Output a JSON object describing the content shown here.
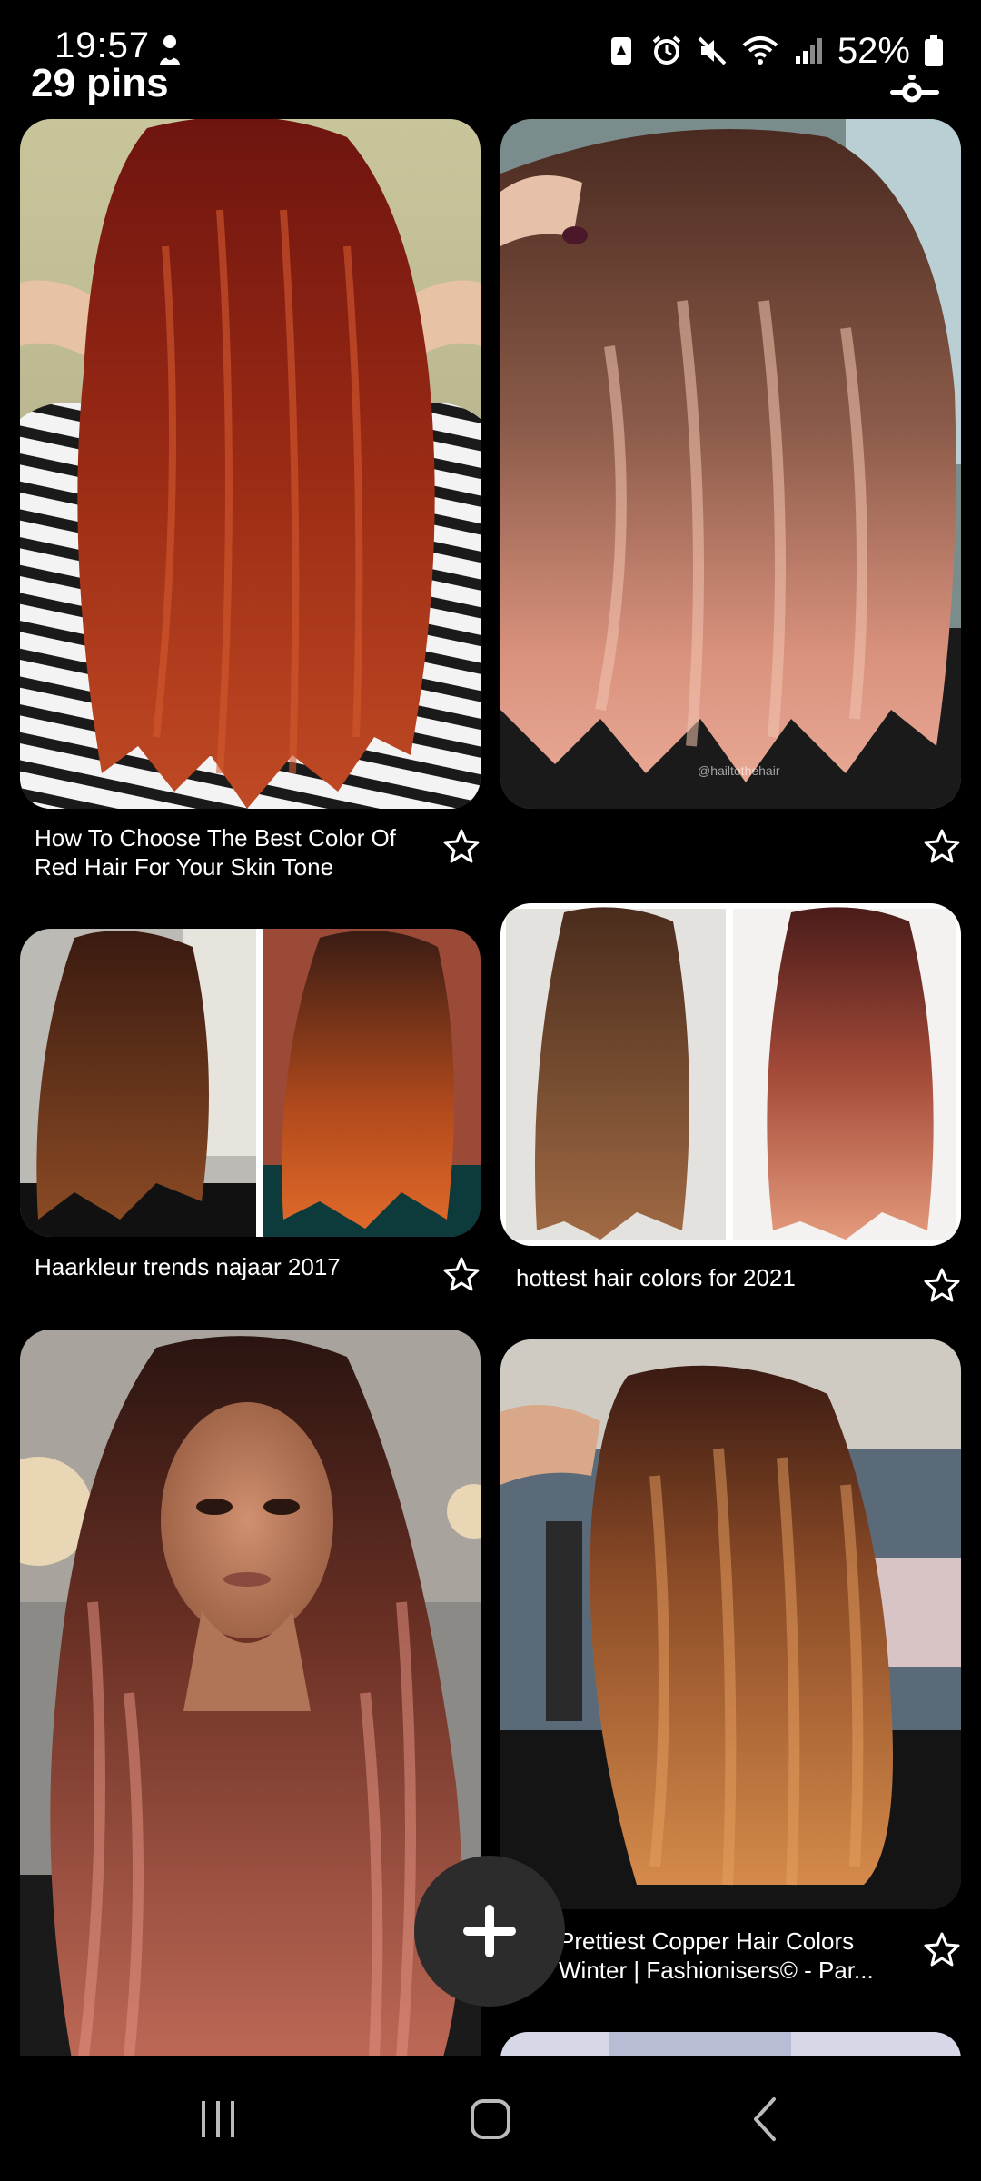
{
  "status_bar": {
    "time": "19:57",
    "battery": "52%",
    "icons": [
      "assistant-icon",
      "battery-saver-icon",
      "alarm-icon",
      "mute-icon",
      "wifi-icon",
      "signal-icon",
      "battery-icon"
    ]
  },
  "header": {
    "pins_count": "29 pins"
  },
  "pins": [
    {
      "title": "How To Choose The Best Color Of Red Hair For Your Skin Tone"
    },
    {
      "title": "",
      "watermark": "@hailtothehair"
    },
    {
      "title": "Haarkleur trends najaar 2017"
    },
    {
      "title": "hottest hair colors for 2021"
    },
    {
      "title": ""
    },
    {
      "title": "Prettiest Copper Hair Colors Winter | Fashionisers© - Par..."
    }
  ],
  "fab": {
    "icon": "plus-icon"
  },
  "nav": {
    "icons": [
      "recents-icon",
      "home-icon",
      "back-icon"
    ]
  },
  "colors": {
    "background": "#000000",
    "text": "#ffffff",
    "fab": "#2c2c2c"
  }
}
